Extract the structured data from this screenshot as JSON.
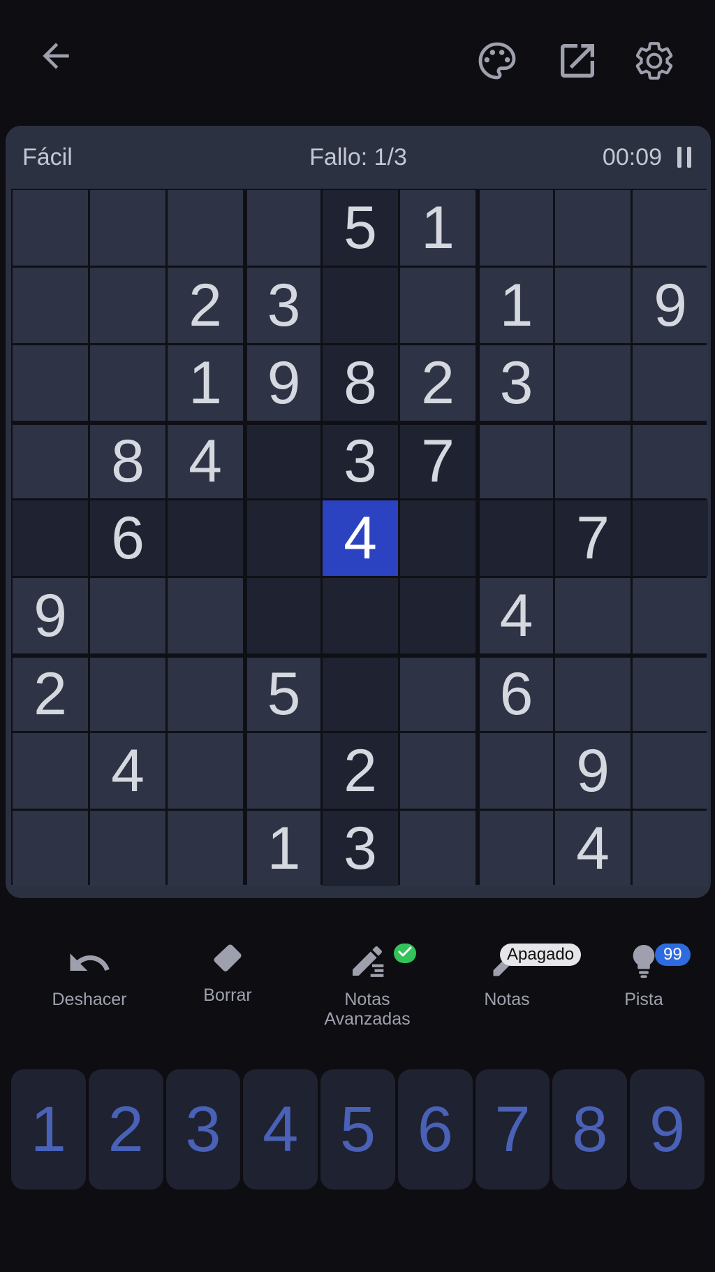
{
  "topbar": {
    "icons": [
      "back-arrow-icon",
      "palette-icon",
      "open-external-icon",
      "settings-gear-icon"
    ]
  },
  "status": {
    "difficulty": "Fácil",
    "mistakes": "Fallo: 1/3",
    "timer": "00:09"
  },
  "board": {
    "rows": [
      [
        "",
        "",
        "",
        "",
        "5",
        "1",
        "",
        "",
        ""
      ],
      [
        "",
        "",
        "2",
        "3",
        "",
        "",
        "1",
        "",
        "9"
      ],
      [
        "",
        "",
        "1",
        "9",
        "8",
        "2",
        "3",
        "",
        ""
      ],
      [
        "",
        "8",
        "4",
        "",
        "3",
        "7",
        "",
        "",
        ""
      ],
      [
        "",
        "6",
        "",
        "",
        "4",
        "",
        "",
        "7",
        ""
      ],
      [
        "9",
        "",
        "",
        "",
        "",
        "",
        "4",
        "",
        ""
      ],
      [
        "2",
        "",
        "",
        "5",
        "",
        "",
        "6",
        "",
        ""
      ],
      [
        "",
        "4",
        "",
        "",
        "2",
        "",
        "",
        "9",
        ""
      ],
      [
        "",
        "",
        "",
        "1",
        "3",
        "",
        "",
        "4",
        ""
      ]
    ],
    "selected": {
      "row": 4,
      "col": 4
    },
    "colors": {
      "cell": "#2e3345",
      "highlight": "#1f2230",
      "selected": "#2b43c0",
      "border": "#0f1016"
    }
  },
  "tools": {
    "undo_label": "Deshacer",
    "erase_label": "Borrar",
    "advanced_notes_label_line1": "Notas",
    "advanced_notes_label_line2": "Avanzadas",
    "notes_label": "Notas",
    "notes_badge": "Apagado",
    "hint_label": "Pista",
    "hint_badge": "99"
  },
  "numpad": {
    "keys": [
      "1",
      "2",
      "3",
      "4",
      "5",
      "6",
      "7",
      "8",
      "9"
    ],
    "color": "#4a61b8"
  }
}
